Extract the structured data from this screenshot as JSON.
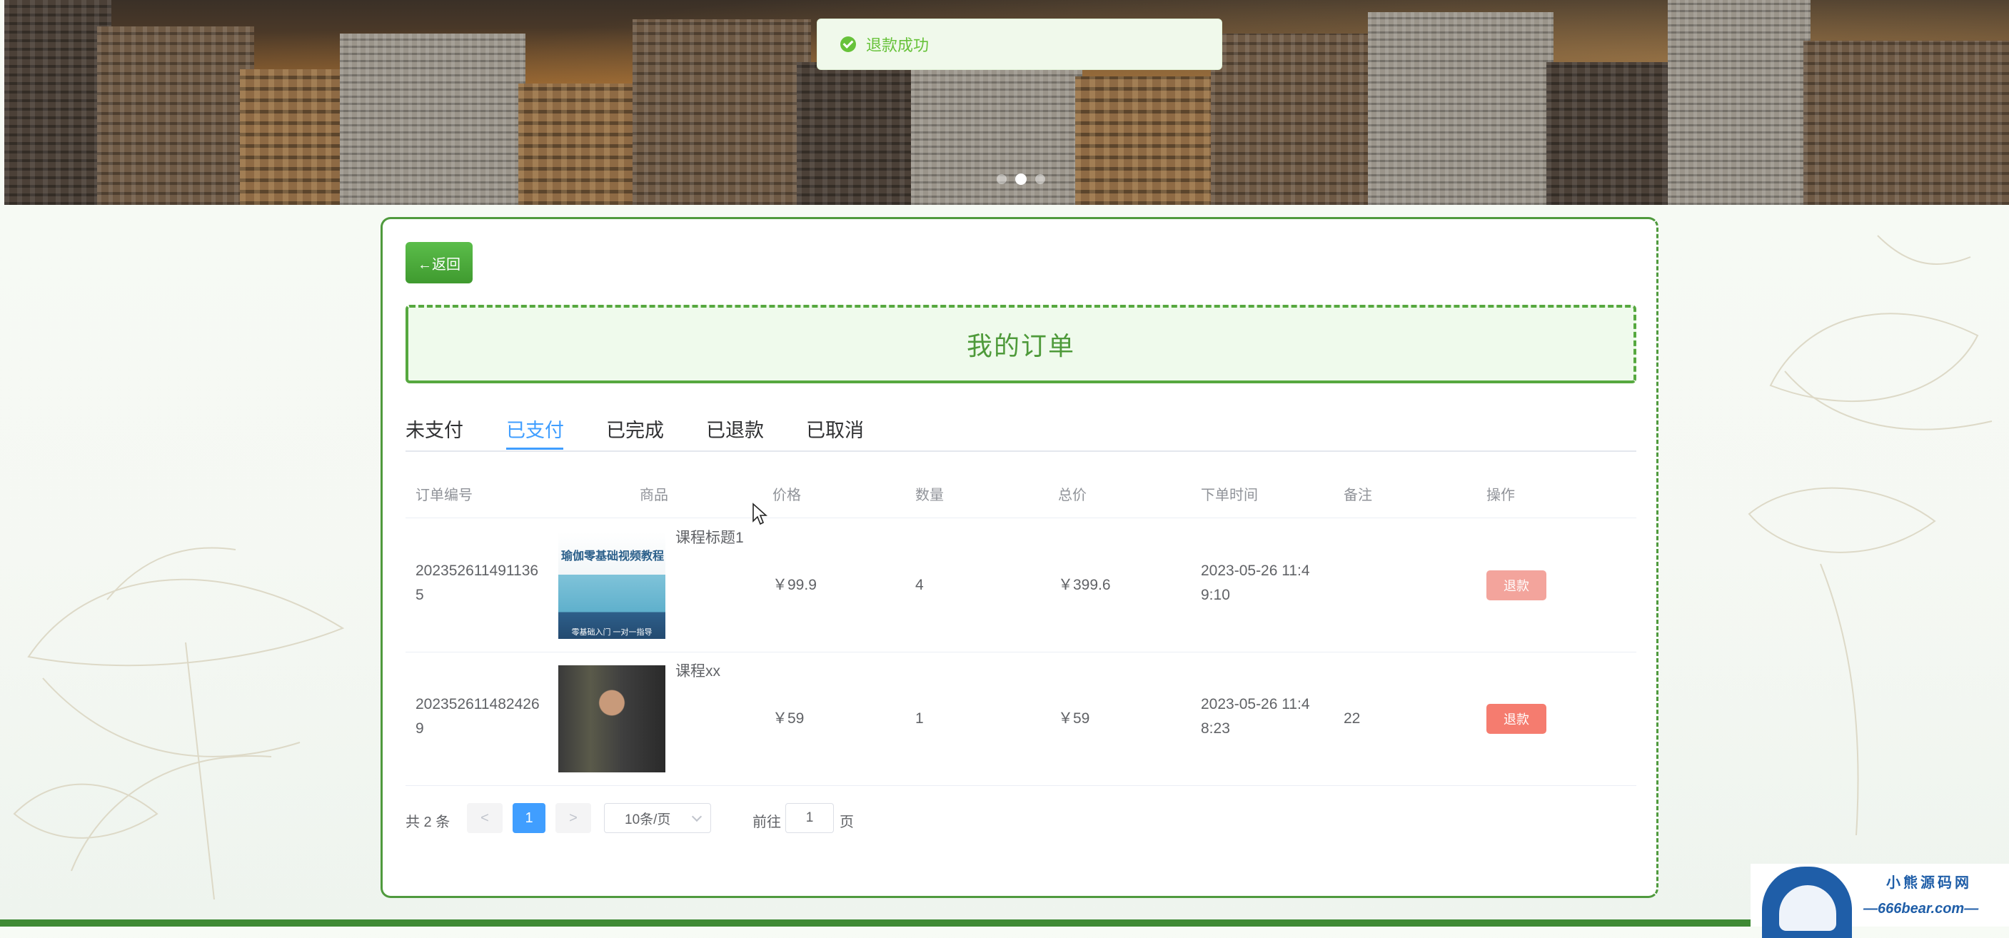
{
  "toast": {
    "message": "退款成功",
    "color": "#67c23a"
  },
  "banner": {
    "dots": 3,
    "active_dot": 2
  },
  "back_button": {
    "label": "←返回",
    "color": "#44a535"
  },
  "page_title": "我的订单",
  "tabs": [
    {
      "label": "未支付",
      "active": false
    },
    {
      "label": "已支付",
      "active": true
    },
    {
      "label": "已完成",
      "active": false
    },
    {
      "label": "已退款",
      "active": false
    },
    {
      "label": "已取消",
      "active": false
    }
  ],
  "table": {
    "headers": [
      "订单编号",
      "商品",
      "价格",
      "数量",
      "总价",
      "下单时间",
      "备注",
      "操作"
    ],
    "rows": [
      {
        "order_no": "2023526114911365",
        "product_name": "课程标题1",
        "thumb_title": "瑜伽零基础视频教程",
        "thumb_sub": "零基础入门 一对一指导",
        "price": "￥99.9",
        "quantity": "4",
        "total": "￥399.6",
        "time": "2023-05-26 11:49:10",
        "note": "",
        "action": "退款",
        "action_color": "#f3a49c"
      },
      {
        "order_no": "2023526114824269",
        "product_name": "课程xx",
        "thumb_title": "",
        "thumb_sub": "",
        "price": "￥59",
        "quantity": "1",
        "total": "￥59",
        "time": "2023-05-26 11:48:23",
        "note": "22",
        "action": "退款",
        "action_color": "#f57c6f"
      }
    ]
  },
  "pagination": {
    "total_text": "共 2 条",
    "prev": "<",
    "current_page": "1",
    "next": ">",
    "page_size": "10条/页",
    "goto_label": "前往",
    "goto_value": "1",
    "page_unit": "页"
  },
  "watermark": {
    "brand": "小熊源码网",
    "site": "—666bear.com—"
  },
  "colors": {
    "accent": "#409eff",
    "green": "#4f9a3d",
    "title_bg": "#effaec"
  }
}
